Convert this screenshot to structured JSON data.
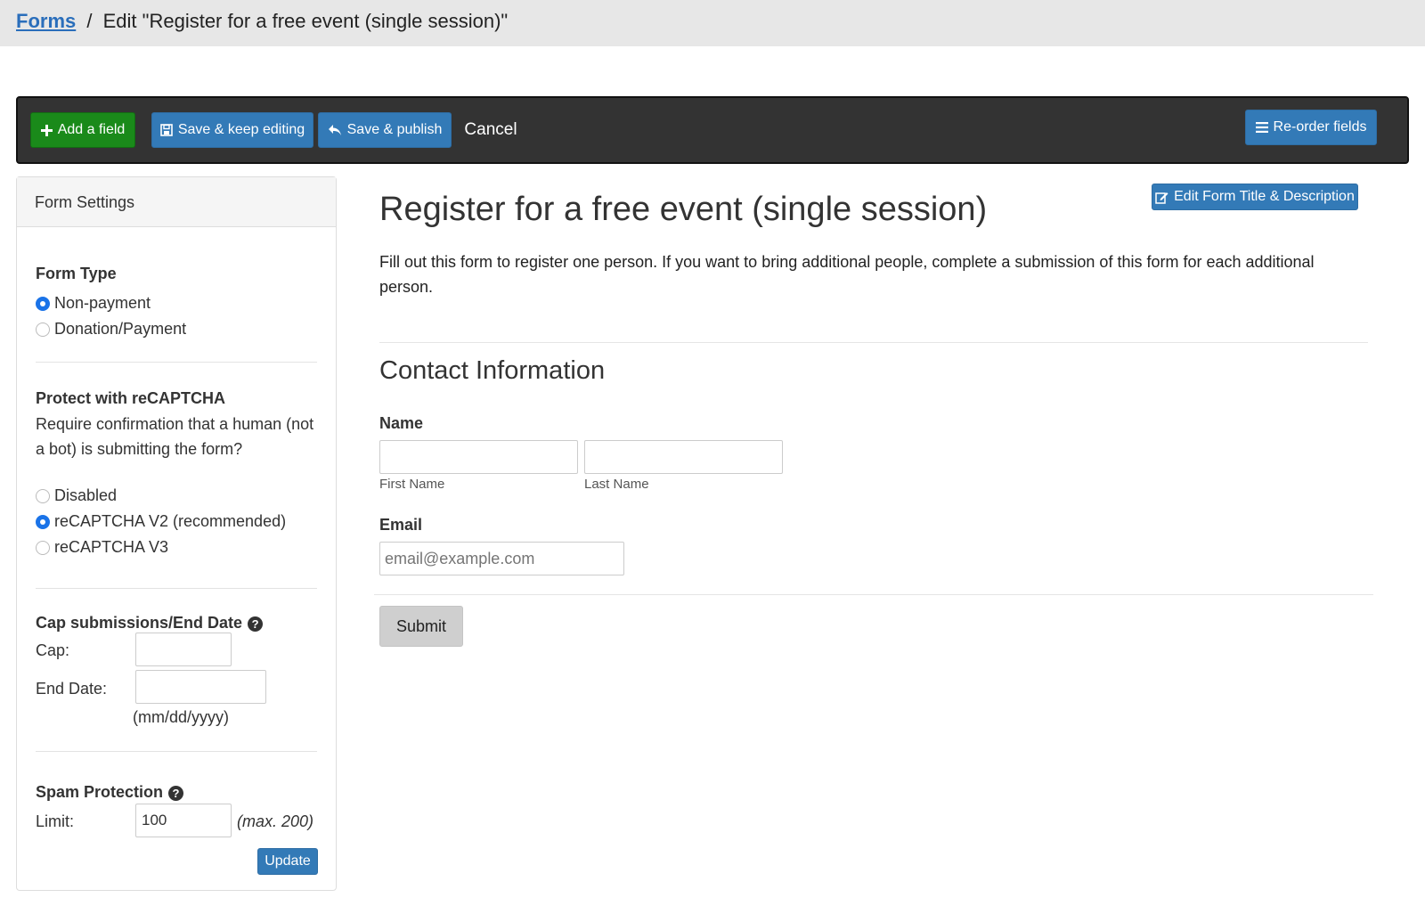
{
  "breadcrumb": {
    "forms_link": "Forms",
    "separator": "/",
    "current": "Edit \"Register for a free event (single session)\""
  },
  "toolbar": {
    "add_field": "Add a field",
    "save_keep_editing": "Save & keep editing",
    "save_publish": "Save & publish",
    "cancel": "Cancel",
    "reorder_fields": "Re-order fields"
  },
  "settings": {
    "header": "Form Settings",
    "form_type": {
      "title": "Form Type",
      "options": [
        {
          "label": "Non-payment",
          "selected": true
        },
        {
          "label": "Donation/Payment",
          "selected": false
        }
      ]
    },
    "recaptcha": {
      "title": "Protect with reCAPTCHA",
      "description": "Require confirmation that a human (not a bot) is submitting the form?",
      "options": [
        {
          "label": "Disabled",
          "selected": false
        },
        {
          "label": "reCAPTCHA V2 (recommended)",
          "selected": true
        },
        {
          "label": "reCAPTCHA V3",
          "selected": false
        }
      ]
    },
    "cap": {
      "title": "Cap submissions/End Date",
      "cap_label": "Cap:",
      "cap_value": "",
      "end_date_label": "End Date:",
      "end_date_value": "",
      "date_hint": "(mm/dd/yyyy)"
    },
    "spam": {
      "title": "Spam Protection",
      "limit_label": "Limit:",
      "limit_value": "100",
      "max_hint": "(max. 200)",
      "update": "Update"
    }
  },
  "form": {
    "edit_title_button": "Edit Form Title & Description",
    "title": "Register for a free event (single session)",
    "description": "Fill out this form to register one person. If you want to bring additional people, complete a submission of this form for each additional person.",
    "section_heading": "Contact Information",
    "name_label": "Name",
    "first_name_sublabel": "First Name",
    "last_name_sublabel": "Last Name",
    "email_label": "Email",
    "email_placeholder": "email@example.com",
    "submit": "Submit"
  },
  "colors": {
    "primary_blue": "#337ab7",
    "green": "#1a8a1a",
    "toolbar_bg": "#333333",
    "link": "#2a6ebb",
    "radio_selected": "#1a73e8"
  }
}
